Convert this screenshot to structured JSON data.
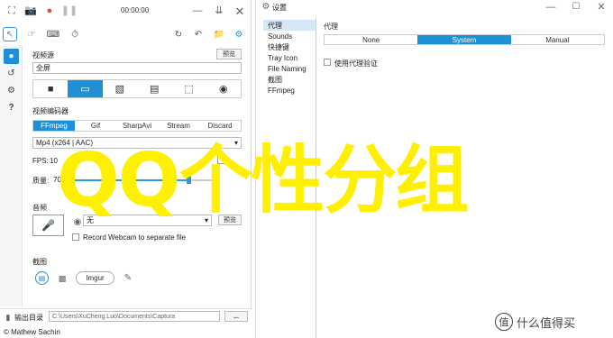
{
  "window1": {
    "timer": "00:00:00",
    "video_source": {
      "label": "视频源",
      "preview_button": "预览",
      "source_value": "全屏",
      "modes": [
        "camera",
        "screen",
        "monitor",
        "window",
        "region",
        "gamepad"
      ],
      "active_mode": 1
    },
    "encoder": {
      "label": "视频编码器",
      "options": [
        "FFmpeg",
        "Gif",
        "SharpAvi",
        "Stream",
        "Discard"
      ],
      "active": 0,
      "format_value": "Mp4 (x264 | AAC)"
    },
    "fps": {
      "label": "FPS:",
      "value": "10"
    },
    "quality": {
      "label": "质量:",
      "value": "70"
    },
    "audio": {
      "label": "音频",
      "device": "无"
    },
    "webcam": {
      "preview_button": "预览",
      "checkbox_label": "Record Webcam to separate file"
    },
    "screenshot": {
      "label": "截图",
      "imgur_button": "Imgur"
    },
    "footer": {
      "output_label": "输出目录",
      "path_value": "C:\\Users\\XuCheng.Luo\\Documents\\Captura",
      "browse_button": "...",
      "author": "© Mathew Sachin"
    }
  },
  "window2": {
    "title": "设置",
    "nav": [
      "代理",
      "Sounds",
      "快捷键",
      "Tray Icon",
      "File Naming",
      "截图",
      "FFmpeg"
    ],
    "active_nav": 0,
    "section_title": "代理",
    "proxy_options": [
      "None",
      "System",
      "Manual"
    ],
    "proxy_active": 1,
    "auth_checkbox": "使用代理验证"
  },
  "overlay": {
    "watermark": "QQ个性分组",
    "logo_text": "什么值得买"
  },
  "colors": {
    "accent": "#1f8fd6",
    "watermark": "#ffef00"
  }
}
